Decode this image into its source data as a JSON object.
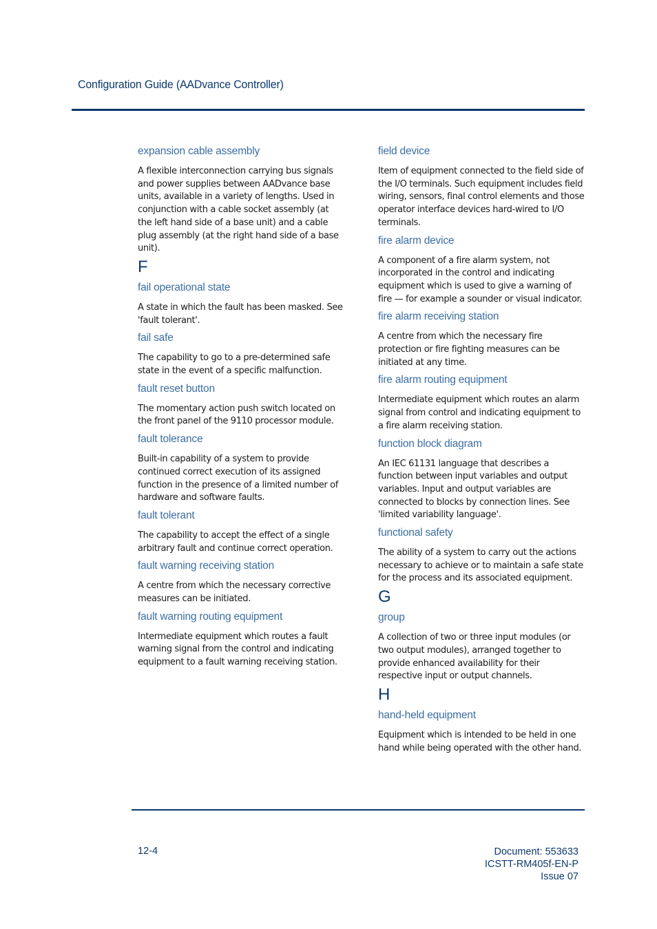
{
  "header": {
    "title": "Configuration Guide (AADvance Controller)"
  },
  "left_column": {
    "entry_expansion": {
      "term": "expansion cable assembly",
      "definition": "A flexible interconnection carrying bus signals and power supplies between AADvance base units, available in a variety of lengths. Used in conjunction with a cable socket assembly (at the left hand side of a base unit) and a cable plug assembly (at the right hand side of a base unit)."
    },
    "letter_f": "F",
    "entries": [
      {
        "term": "fail operational state",
        "definition": "A state in which the fault has been masked. See 'fault tolerant'."
      },
      {
        "term": "fail safe",
        "definition": "The capability to go to a pre-determined safe state in the event of a specific malfunction."
      },
      {
        "term": "fault reset button",
        "definition": "The momentary action push switch located on the front panel of the 9110 processor module."
      },
      {
        "term": "fault tolerance",
        "definition": "Built-in capability of a system to provide continued correct execution of its assigned function in the presence of a limited number of hardware and software faults."
      },
      {
        "term": "fault tolerant",
        "definition": "The capability to accept the effect of a single arbitrary fault and continue correct operation."
      },
      {
        "term": "fault warning receiving station",
        "definition": "A centre from which the necessary corrective measures can be initiated."
      },
      {
        "term": "fault warning routing equipment",
        "definition": "Intermediate equipment which routes a fault warning signal from the control and indicating equipment to a fault warning receiving station."
      }
    ]
  },
  "right_column": {
    "entries_f": [
      {
        "term": "field device",
        "definition": "Item of equipment connected to the field side of the I/O terminals. Such equipment includes field wiring, sensors, final control elements and those operator interface devices hard-wired to I/O terminals."
      },
      {
        "term": "fire alarm device",
        "definition": "A component of a fire alarm system, not incorporated in the control and indicating equipment which is used to give a warning of fire — for example a sounder or visual indicator."
      },
      {
        "term": "fire alarm receiving station",
        "definition": "A centre from which the necessary fire protection or fire fighting measures can be initiated at any time."
      },
      {
        "term": "fire alarm routing equipment",
        "definition": "Intermediate equipment which routes an alarm signal from control and indicating equipment to a fire alarm receiving station."
      },
      {
        "term": "function block diagram",
        "definition": "An IEC 61131 language that describes a function between input variables and output variables. Input and output variables are connected to blocks by connection lines. See 'limited variability language'."
      },
      {
        "term": "functional safety",
        "definition": "The ability of a system to carry out the actions necessary to achieve or to maintain a safe state for the process and its associated equipment."
      }
    ],
    "letter_g": "G",
    "entries_g": [
      {
        "term": "group",
        "definition": "A collection of two or three input modules (or two output modules), arranged together to provide enhanced availability for their respective input or output channels."
      }
    ],
    "letter_h": "H",
    "entries_h": [
      {
        "term": "hand-held equipment",
        "definition": "Equipment which is intended to be held in one hand while being operated with the other hand."
      }
    ]
  },
  "footer": {
    "page_number": "12-4",
    "document": "Document: 553633",
    "publication": "ICSTT-RM405f-EN-P",
    "issue": "Issue 07"
  }
}
